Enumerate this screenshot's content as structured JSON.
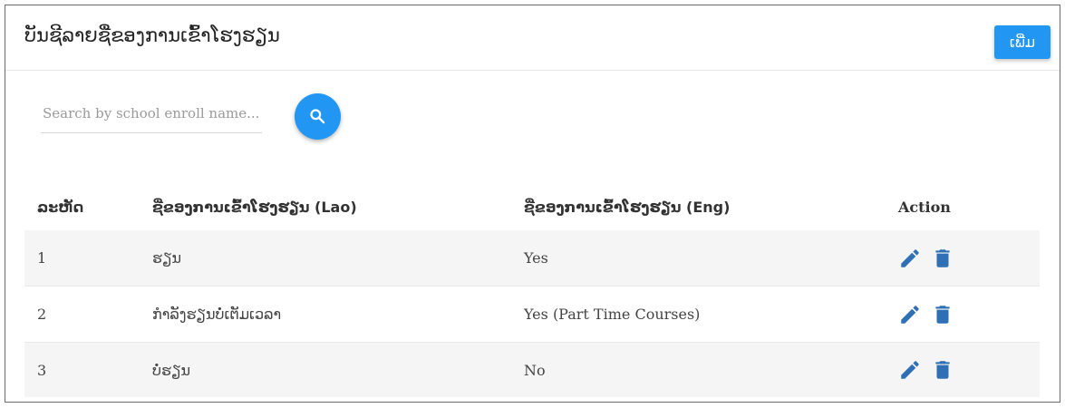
{
  "header": {
    "title": "ບັນຊີລາຍຊື່ຂອງການເຂົ້າໂຮງຮຽນ",
    "add_label": "ເພີ່ມ"
  },
  "search": {
    "placeholder": "Search by school enroll name...",
    "value": ""
  },
  "table": {
    "columns": [
      "ລະຫັດ",
      "ຊື່ຂອງການເຂົ້າໂຮງຮຽນ (Lao)",
      "ຊື່ຂອງການເຂົ້າໂຮງຮຽນ (Eng)",
      "Action"
    ],
    "rows": [
      {
        "id": "1",
        "name_lao": "ຮຽນ",
        "name_eng": "Yes"
      },
      {
        "id": "2",
        "name_lao": "ກຳລັງຮຽນບໍ່ເຕັມເວລາ",
        "name_eng": "Yes (Part Time Courses)"
      },
      {
        "id": "3",
        "name_lao": "ບໍ່ຮຽນ",
        "name_eng": "No"
      }
    ],
    "row_actions": [
      "edit-icon",
      "delete-icon"
    ]
  },
  "colors": {
    "accent": "#2196f3",
    "icon": "#2f6fb3"
  }
}
